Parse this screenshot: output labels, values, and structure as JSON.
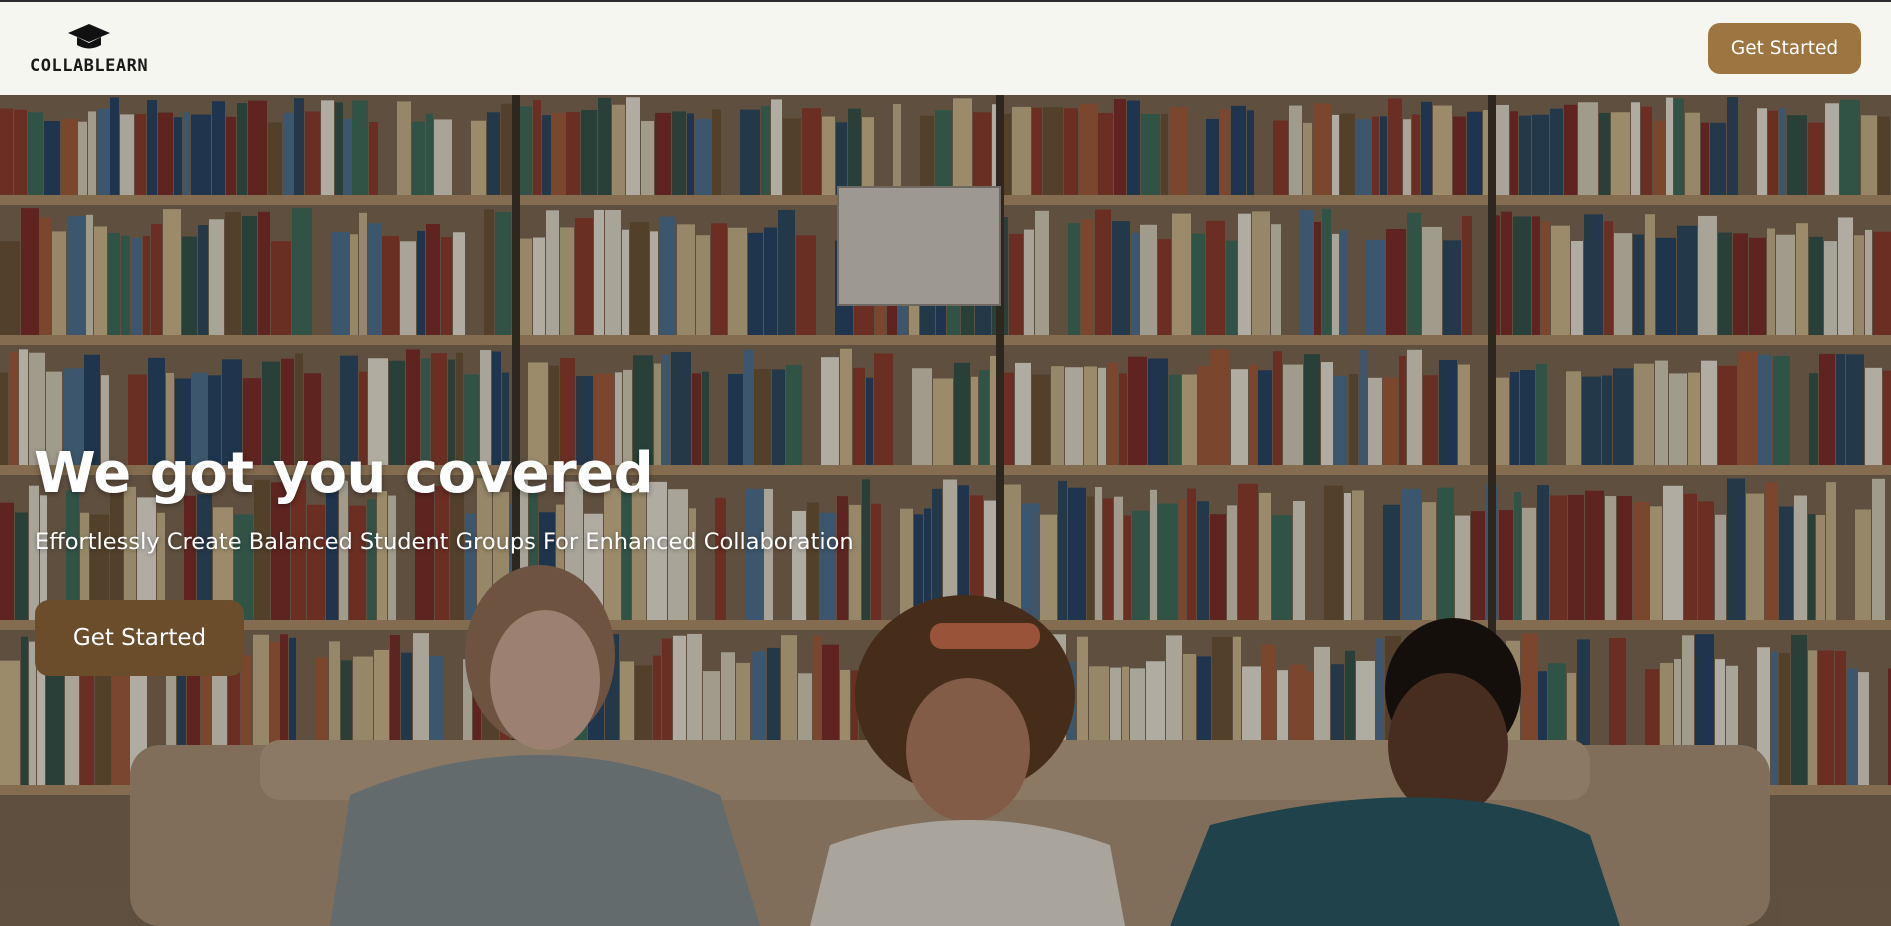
{
  "navbar": {
    "logo_text": "COLLABLEARN",
    "logo_icon": "graduation-cap-icon",
    "cta_label": "Get Started"
  },
  "hero": {
    "title": "We got you covered",
    "subtitle": "Effortlessly Create Balanced Student Groups For Enhanced Collaboration",
    "cta_label": "Get Started",
    "background_image": "library-bookshelves-three-students-studying"
  },
  "colors": {
    "navbar_bg": "#f6f6f0",
    "nav_button": "#9c7540",
    "hero_button": "#6b4d2c",
    "text_on_hero": "#ffffff"
  }
}
